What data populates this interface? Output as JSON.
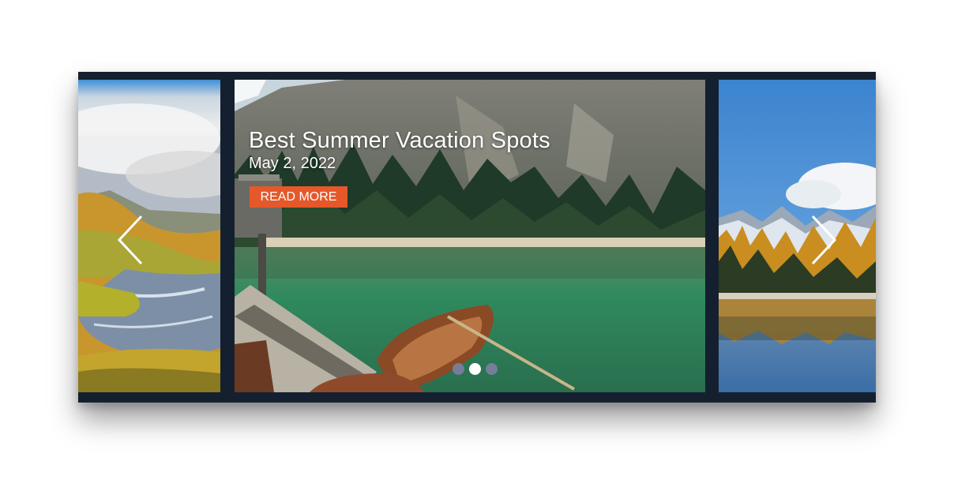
{
  "slider": {
    "slides": [
      {
        "id": "left",
        "scene": "highland valley with stream"
      },
      {
        "id": "center",
        "scene": "mountain lake with rowboats"
      },
      {
        "id": "right",
        "scene": "autumn larches reflected in alpine lake"
      }
    ],
    "active_caption": {
      "title": "Best Summer Vacation Spots",
      "date": "May 2, 2022",
      "button_label": "READ MORE"
    },
    "pagination": {
      "count": 3,
      "active_index": 1
    },
    "icons": {
      "prev": "chevron-left-icon",
      "next": "chevron-right-icon"
    },
    "colors": {
      "frame": "#14202f",
      "button": "#e5582a",
      "dot_inactive": "#7c7fa2",
      "dot_active": "#ffffff"
    }
  }
}
